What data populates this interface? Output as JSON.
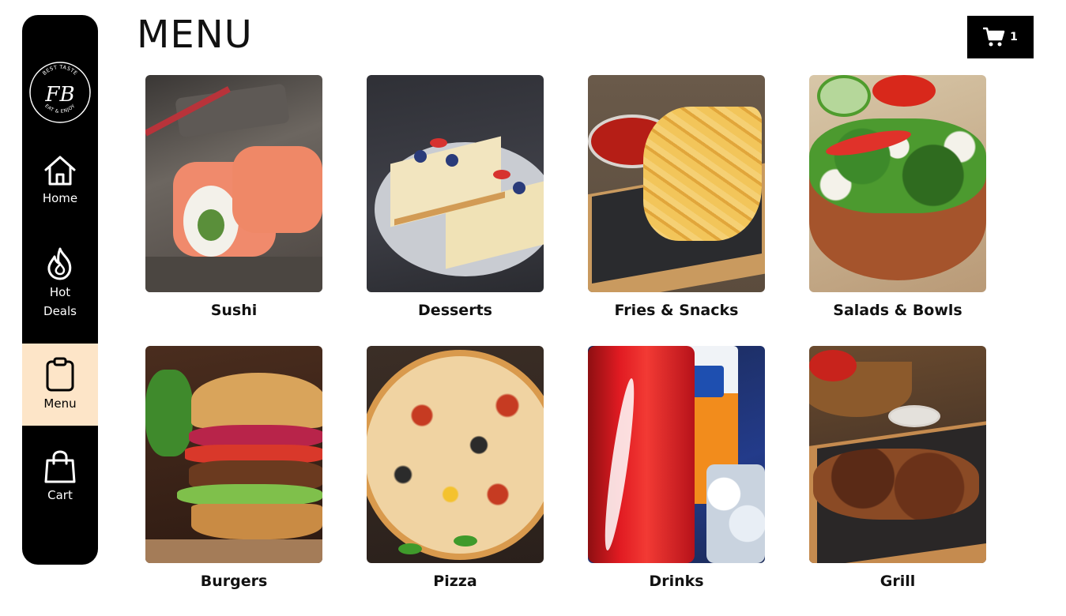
{
  "page": {
    "title": "MENU"
  },
  "sidebar": {
    "logo": {
      "monogram": "FB",
      "top_text": "BEST TASTE",
      "bottom_text": "EAT & ENJOY",
      "icon": "fb-logo"
    },
    "items": [
      {
        "label": "Home",
        "icon": "home-icon",
        "active": false
      },
      {
        "label": "Hot\nDeals",
        "icon": "flame-icon",
        "active": false
      },
      {
        "label": "Menu",
        "icon": "clipboard-icon",
        "active": true
      },
      {
        "label": "Cart",
        "icon": "shopping-bag-icon",
        "active": false
      }
    ],
    "active_color": "#fde5c8",
    "background": "#000000"
  },
  "header": {
    "cart": {
      "icon": "cart-icon",
      "count": "1"
    }
  },
  "categories": [
    {
      "label": "Sushi"
    },
    {
      "label": "Desserts"
    },
    {
      "label": "Fries & Snacks"
    },
    {
      "label": "Salads & Bowls"
    },
    {
      "label": "Burgers"
    },
    {
      "label": "Pizza"
    },
    {
      "label": "Drinks"
    },
    {
      "label": "Grill"
    }
  ]
}
